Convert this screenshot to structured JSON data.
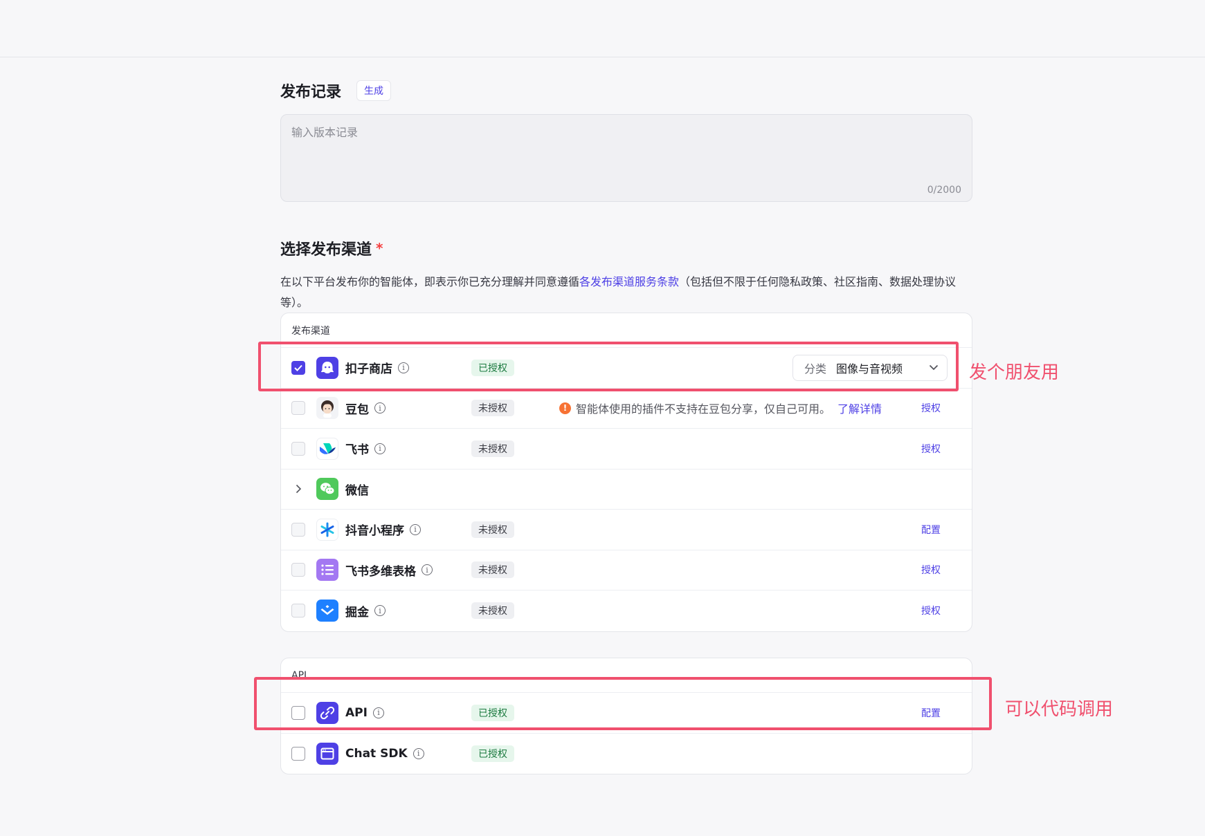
{
  "release_notes": {
    "title": "发布记录",
    "generate_label": "生成",
    "placeholder": "输入版本记录",
    "counter": "0/2000"
  },
  "channels_section": {
    "title": "选择发布渠道",
    "required_mark": "*",
    "desc_before": "在以下平台发布你的智能体，即表示你已充分理解并同意遵循",
    "desc_link": "各发布渠道服务条款",
    "desc_after": "（包括但不限于任何隐私政策、社区指南、数据处理协议等）。"
  },
  "channels_card": {
    "header": "发布渠道",
    "rows": [
      {
        "name": "扣子商店",
        "icon": "coze-store-icon",
        "checked": true,
        "badge": "已授权",
        "badge_type": "ok",
        "select_label": "分类",
        "select_value": "图像与音视频"
      },
      {
        "name": "豆包",
        "icon": "doubao-avatar-icon",
        "checked": false,
        "badge": "未授权",
        "badge_type": "no",
        "warning": "智能体使用的插件不支持在豆包分享，仅自己可用。",
        "warning_link": "了解详情",
        "action": "授权"
      },
      {
        "name": "飞书",
        "icon": "feishu-icon",
        "checked": false,
        "badge": "未授权",
        "badge_type": "no",
        "action": "授权"
      },
      {
        "name": "微信",
        "icon": "wechat-icon",
        "expandable": true
      },
      {
        "name": "抖音小程序",
        "icon": "douyin-miniapp-icon",
        "checked": false,
        "badge": "未授权",
        "badge_type": "no",
        "action": "配置"
      },
      {
        "name": "飞书多维表格",
        "icon": "feishu-bitable-icon",
        "checked": false,
        "badge": "未授权",
        "badge_type": "no",
        "action": "授权"
      },
      {
        "name": "掘金",
        "icon": "juejin-icon",
        "checked": false,
        "badge": "未授权",
        "badge_type": "no",
        "action": "授权"
      }
    ]
  },
  "api_card": {
    "header": "API",
    "rows": [
      {
        "name": "API",
        "icon": "api-link-icon",
        "checked": false,
        "badge": "已授权",
        "badge_type": "ok",
        "action": "配置"
      },
      {
        "name": "Chat SDK",
        "icon": "chat-sdk-window-icon",
        "checked": false,
        "badge": "已授权",
        "badge_type": "ok"
      }
    ]
  },
  "annotations": {
    "coze_store_note": "发个朋友用",
    "api_note": "可以代码调用"
  },
  "colors": {
    "accent": "#4e40e5",
    "annotation": "#f0506e",
    "authorized_bg": "#e6f6ec",
    "unauthorized_bg": "#eeeff2",
    "warning": "#f77234"
  }
}
